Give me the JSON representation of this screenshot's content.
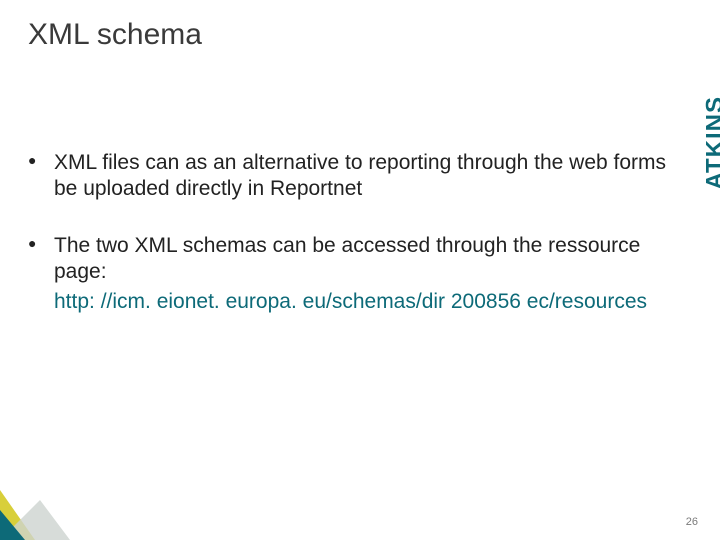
{
  "title": "XML schema",
  "logo": "ATKINS",
  "bullets": [
    {
      "text": "XML files can as an alternative to reporting through the web forms be uploaded directly in Reportnet"
    },
    {
      "text": "The two XML schemas can be accessed through the ressource page:",
      "link": "http: //icm. eionet. europa. eu/schemas/dir 200856 ec/resources"
    }
  ],
  "page_number": "26",
  "colors": {
    "brand": "#0d6a78",
    "accent_yellow": "#d8cf3a",
    "accent_grey": "#cdd3cf"
  }
}
